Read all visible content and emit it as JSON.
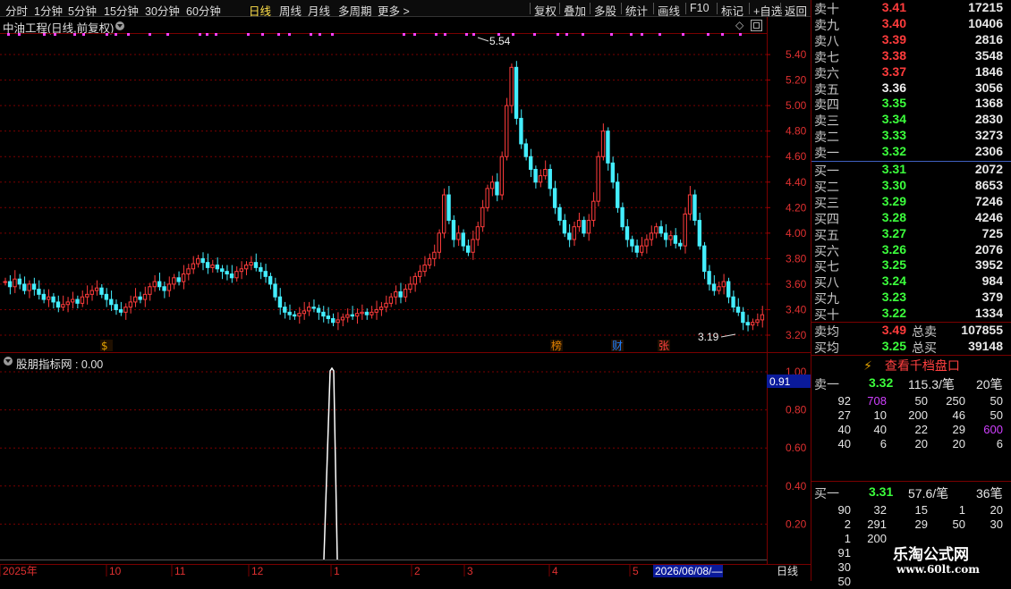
{
  "toolbar": {
    "periods": [
      "分时",
      "1分钟",
      "5分钟",
      "15分钟",
      "30分钟",
      "60分钟",
      "日线",
      "周线",
      "月线",
      "多周期",
      "更多 >"
    ],
    "active": "日线",
    "tools": [
      "复权",
      "叠加",
      "多股",
      "统计",
      "画线",
      "F10",
      "标记",
      "+自选",
      "返回"
    ]
  },
  "chart": {
    "title": "中油工程(日线,前复权)",
    "high_label": "5.54",
    "low_label": "3.19",
    "y_ticks": [
      "5.40",
      "5.20",
      "5.00",
      "4.80",
      "4.60",
      "4.40",
      "4.20",
      "4.00",
      "3.80",
      "3.60",
      "3.40",
      "3.20"
    ],
    "markers": [
      "$",
      "榜",
      "财",
      "张"
    ],
    "colors": {
      "up": "#ff3c3c",
      "down": "#44eeff",
      "grid": "#7a0000",
      "dots": "#ff40ff"
    }
  },
  "indicator": {
    "title": "股朋指标网 : 0.00",
    "y_ticks": [
      "1.00",
      "0.80",
      "0.60",
      "0.40",
      "0.20"
    ],
    "cursor_value": "0.91"
  },
  "x_axis": {
    "labels": [
      "2025年",
      "10",
      "11",
      "12",
      "1",
      "2",
      "3",
      "4",
      "5"
    ],
    "date_box": "2026/06/08/—",
    "period_label": "日线"
  },
  "orderbook": {
    "asks": [
      {
        "label": "卖十",
        "price": "3.41",
        "vol": "17215",
        "cls": "up"
      },
      {
        "label": "卖九",
        "price": "3.40",
        "vol": "10406",
        "cls": "up"
      },
      {
        "label": "卖八",
        "price": "3.39",
        "vol": "2816",
        "cls": "up"
      },
      {
        "label": "卖七",
        "price": "3.38",
        "vol": "3548",
        "cls": "up"
      },
      {
        "label": "卖六",
        "price": "3.37",
        "vol": "1846",
        "cls": "up"
      },
      {
        "label": "卖五",
        "price": "3.36",
        "vol": "3056",
        "cls": "wh"
      },
      {
        "label": "卖四",
        "price": "3.35",
        "vol": "1368",
        "cls": "dn"
      },
      {
        "label": "卖三",
        "price": "3.34",
        "vol": "2830",
        "cls": "dn"
      },
      {
        "label": "卖二",
        "price": "3.33",
        "vol": "3273",
        "cls": "dn"
      },
      {
        "label": "卖一",
        "price": "3.32",
        "vol": "2306",
        "cls": "dn"
      }
    ],
    "bids": [
      {
        "label": "买一",
        "price": "3.31",
        "vol": "2072",
        "cls": "dn"
      },
      {
        "label": "买二",
        "price": "3.30",
        "vol": "8653",
        "cls": "dn"
      },
      {
        "label": "买三",
        "price": "3.29",
        "vol": "7246",
        "cls": "dn"
      },
      {
        "label": "买四",
        "price": "3.28",
        "vol": "4246",
        "cls": "dn"
      },
      {
        "label": "买五",
        "price": "3.27",
        "vol": "725",
        "cls": "dn"
      },
      {
        "label": "买六",
        "price": "3.26",
        "vol": "2076",
        "cls": "dn"
      },
      {
        "label": "买七",
        "price": "3.25",
        "vol": "3952",
        "cls": "dn"
      },
      {
        "label": "买八",
        "price": "3.24",
        "vol": "984",
        "cls": "dn"
      },
      {
        "label": "买九",
        "price": "3.23",
        "vol": "379",
        "cls": "dn"
      },
      {
        "label": "买十",
        "price": "3.22",
        "vol": "1334",
        "cls": "dn"
      }
    ],
    "avg_ask_label": "卖均",
    "avg_ask": "3.49",
    "total_ask_label": "总卖",
    "total_ask": "107855",
    "avg_bid_label": "买均",
    "avg_bid": "3.25",
    "total_bid_label": "总买",
    "total_bid": "39148",
    "qianfang_button": "查看千档盘口"
  },
  "queue": {
    "ask_label": "卖一",
    "ask_price": "3.32",
    "ask_avg": "115.3/笔",
    "ask_count": "20笔",
    "ask_rows": [
      [
        "92",
        "708",
        "50",
        "250",
        "50"
      ],
      [
        "27",
        "10",
        "200",
        "46",
        "50"
      ],
      [
        "40",
        "40",
        "22",
        "29",
        "600"
      ],
      [
        "40",
        "6",
        "20",
        "20",
        "6"
      ]
    ],
    "bid_label": "买一",
    "bid_price": "3.31",
    "bid_avg": "57.6/笔",
    "bid_count": "36笔",
    "bid_rows": [
      [
        "90",
        "32",
        "15",
        "1",
        "20"
      ],
      [
        "2",
        "291",
        "29",
        "50",
        "30"
      ],
      [
        "1",
        "200",
        "",
        "",
        ""
      ],
      [
        "91",
        "",
        "",
        "",
        ""
      ],
      [
        "30",
        "",
        "",
        "",
        ""
      ],
      [
        "50",
        "",
        "",
        "",
        ""
      ]
    ]
  },
  "watermark": {
    "name": "乐淘公式网",
    "url": "www.60lt.com"
  }
}
